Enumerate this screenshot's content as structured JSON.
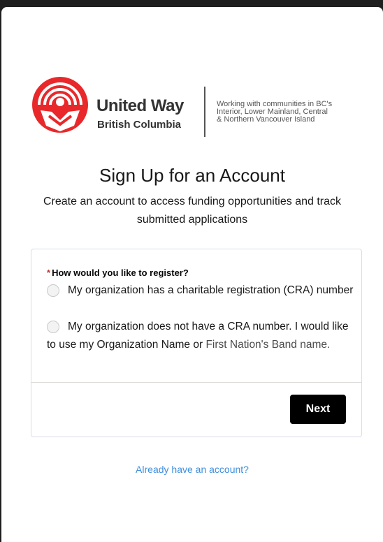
{
  "brand": {
    "name": "United Way",
    "sub": "British Columbia",
    "tagline_lines": [
      "Working with communities in BC's",
      "Interior, Lower Mainland, Central",
      "& Northern Vancouver Island"
    ],
    "color": "#e8282a"
  },
  "page": {
    "title": "Sign Up for an Account",
    "subtitle": "Create an account to access funding opportunities and track submitted applications"
  },
  "form": {
    "required_mark": "*",
    "question": "How would you like to register?",
    "options": [
      {
        "label": "My organization has a charitable registration (CRA) number",
        "selected": false
      },
      {
        "label_main": "My organization does not have a CRA number. I would like to use my Organization Name or",
        "label_tail": "First Nation's Band name.",
        "selected": false
      }
    ],
    "next_label": "Next"
  },
  "footer": {
    "login_link": "Already have an account?"
  },
  "colors": {
    "link": "#3e8ede",
    "button": "#000000",
    "required": "#c23934"
  }
}
